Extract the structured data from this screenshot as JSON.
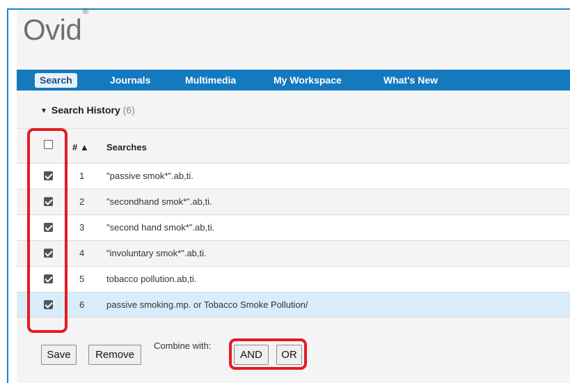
{
  "logo": {
    "text": "Ovid",
    "mark": "®"
  },
  "nav": {
    "items": [
      {
        "label": "Search",
        "active": true
      },
      {
        "label": "Journals",
        "active": false
      },
      {
        "label": "Multimedia",
        "active": false
      },
      {
        "label": "My Workspace",
        "active": false
      },
      {
        "label": "What's New",
        "active": false
      }
    ]
  },
  "history": {
    "title": "Search History",
    "count": "(6)",
    "columns": {
      "num": "# ▲",
      "searches": "Searches"
    },
    "rows": [
      {
        "num": "1",
        "query": "\"passive smok*\".ab,ti.",
        "checked": true
      },
      {
        "num": "2",
        "query": "\"secondhand smok*\".ab,ti.",
        "checked": true
      },
      {
        "num": "3",
        "query": "\"second hand smok*\".ab,ti.",
        "checked": true
      },
      {
        "num": "4",
        "query": "\"involuntary smok*\".ab,ti.",
        "checked": true
      },
      {
        "num": "5",
        "query": "tobacco pollution.ab,ti.",
        "checked": true
      },
      {
        "num": "6",
        "query": "passive smoking.mp. or Tobacco Smoke Pollution/",
        "checked": true
      }
    ],
    "select_all_checked": false
  },
  "actions": {
    "save": "Save",
    "remove": "Remove",
    "combine_label": "Combine with:",
    "and": "AND",
    "or": "OR"
  },
  "colors": {
    "nav_bg": "#1479bf",
    "highlight_row": "#d9ecfa",
    "annotation_red": "#e31b23"
  }
}
